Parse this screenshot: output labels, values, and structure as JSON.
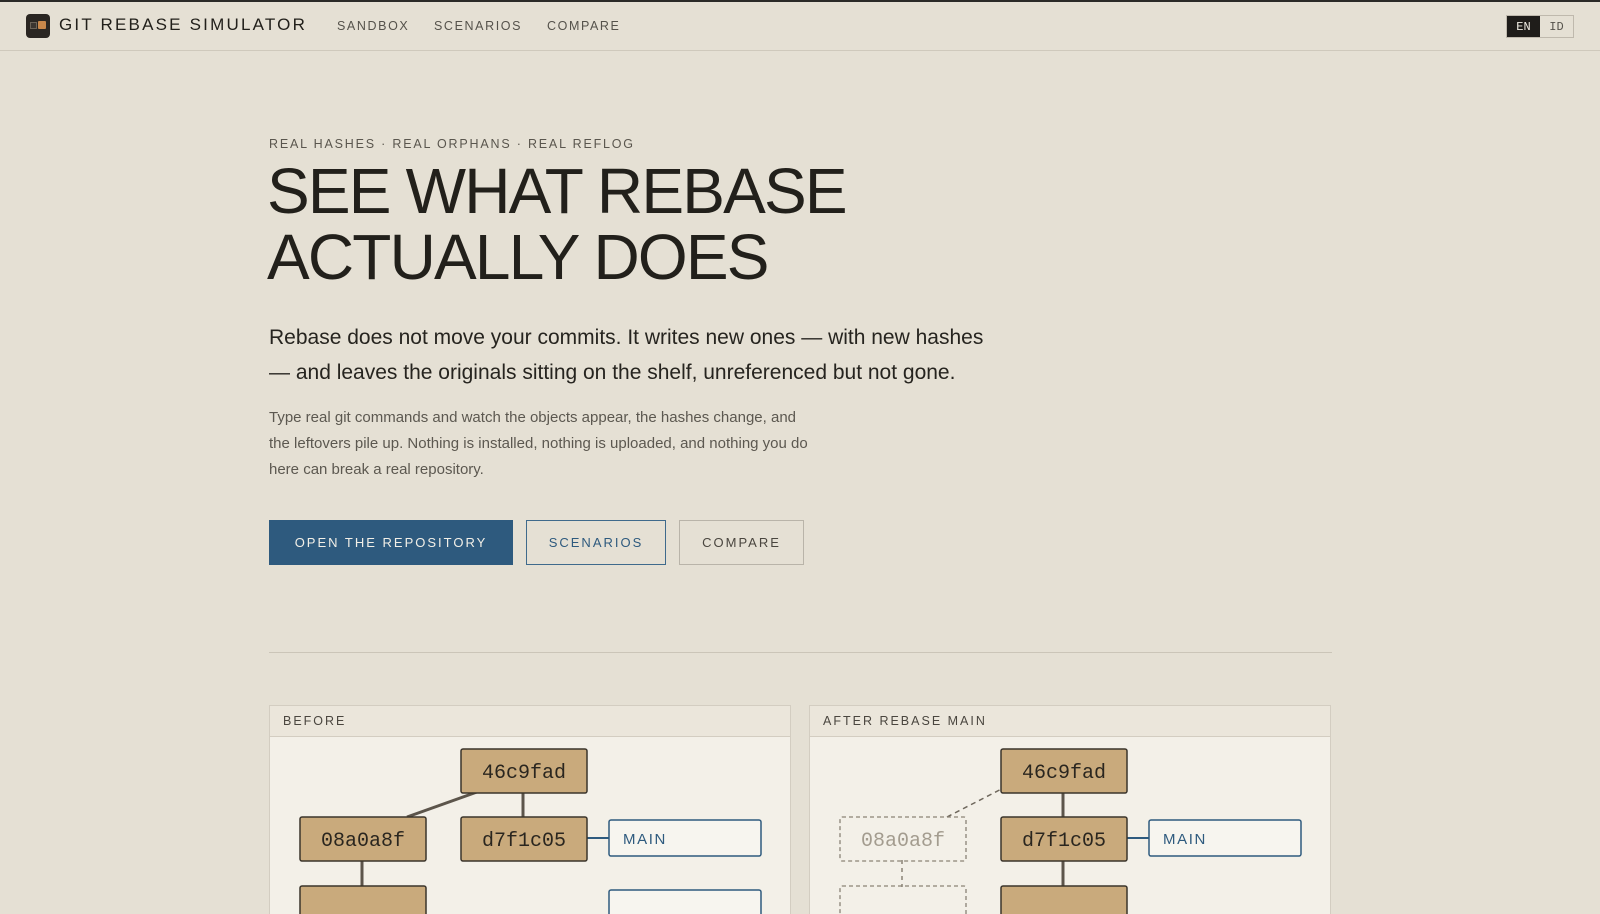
{
  "app": {
    "brand": "GIT REBASE SIMULATOR",
    "nav": [
      "SANDBOX",
      "SCENARIOS",
      "COMPARE"
    ],
    "lang": {
      "active": "EN",
      "other": "ID"
    }
  },
  "hero": {
    "eyebrow": "REAL HASHES · REAL ORPHANS · REAL REFLOG",
    "title_line1": "SEE WHAT REBASE",
    "title_line2": "ACTUALLY DOES",
    "lead": "Rebase does not move your commits. It writes new ones — with new hashes — and leaves the originals sitting on the shelf, unreferenced but not gone.",
    "sub": "Type real git commands and watch the objects appear, the hashes change, and the leftovers pile up. Nothing is installed, nothing is uploaded, and nothing you do here can break a real repository.",
    "buttons": {
      "primary": "OPEN THE REPOSITORY",
      "scenarios": "SCENARIOS",
      "compare": "COMPARE"
    }
  },
  "panels": {
    "before": {
      "label": "BEFORE",
      "commits": {
        "root": "46c9fad",
        "left": "08a0a8f",
        "right": "d7f1c05"
      },
      "ref": "MAIN"
    },
    "after": {
      "label": "AFTER REBASE MAIN",
      "commits": {
        "root": "46c9fad",
        "orphan": "08a0a8f",
        "right": "d7f1c05"
      },
      "ref": "MAIN"
    }
  },
  "colors": {
    "background": "#e5e0d4",
    "accent": "#2e5a7e",
    "commit_fill": "#c9aa7c",
    "panel_fill": "#f3f0e8"
  }
}
